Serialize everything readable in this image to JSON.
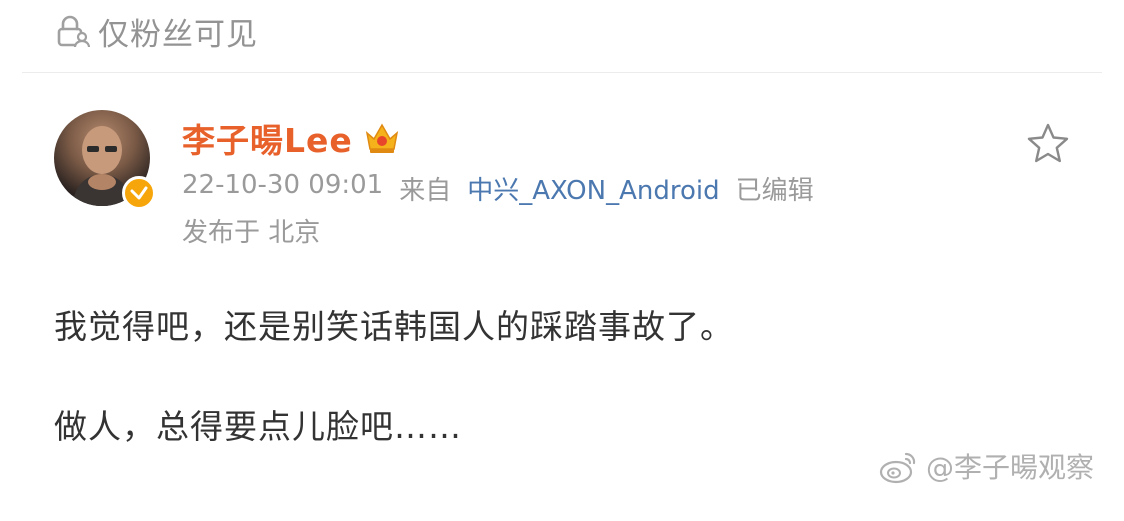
{
  "visibility": {
    "icon": "lock-person-icon",
    "label": "仅粉丝可见"
  },
  "author": {
    "name": "李子暘Lee",
    "badge": "verified-badge",
    "crown": "crown-icon",
    "name_color": "#e8612b"
  },
  "meta": {
    "time": "22-10-30 09:01",
    "from_label": "来自",
    "source": "中兴_AXON_Android",
    "edited": "已编辑",
    "location": "发布于 北京",
    "source_color": "#4c78b0"
  },
  "actions": {
    "favorite_icon": "star-icon"
  },
  "post": {
    "line1": "我觉得吧，还是别笑话韩国人的踩踏事故了。",
    "line2": "做人，总得要点儿脸吧……"
  },
  "watermark": {
    "icon": "weibo-icon",
    "text": "@李子暘观察"
  }
}
